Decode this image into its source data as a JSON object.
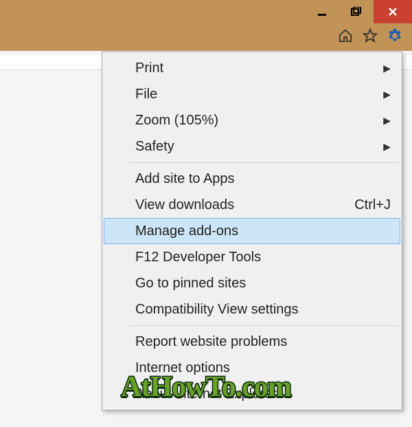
{
  "menu": {
    "group1": [
      {
        "label": "Print",
        "submenu": true
      },
      {
        "label": "File",
        "submenu": true
      },
      {
        "label": "Zoom (105%)",
        "submenu": true
      },
      {
        "label": "Safety",
        "submenu": true
      }
    ],
    "group2": [
      {
        "label": "Add site to Apps"
      },
      {
        "label": "View downloads",
        "shortcut": "Ctrl+J"
      },
      {
        "label": "Manage add-ons",
        "highlighted": true
      },
      {
        "label": "F12 Developer Tools"
      },
      {
        "label": "Go to pinned sites"
      },
      {
        "label": "Compatibility View settings"
      }
    ],
    "group3": [
      {
        "label": "Report website problems"
      },
      {
        "label": "Internet options"
      },
      {
        "label": "About Internet Explorer"
      }
    ]
  },
  "watermark": "AtHowTo.com",
  "colors": {
    "titlebar": "#c19356",
    "close": "#c94030",
    "menu_hover": "#cde6f7",
    "gear": "#1e5fb3"
  }
}
